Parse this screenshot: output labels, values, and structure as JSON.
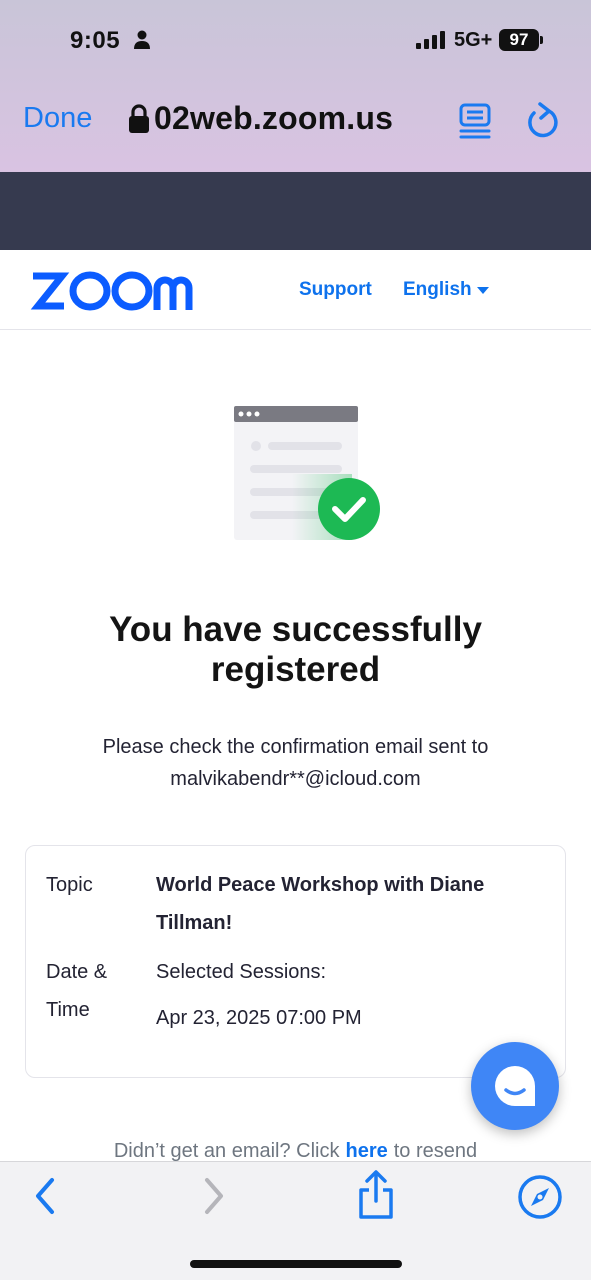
{
  "status_bar": {
    "time": "9:05",
    "network": "5G+",
    "battery": "97"
  },
  "browser": {
    "done_label": "Done",
    "url": "02web.zoom.us"
  },
  "header": {
    "logo_text": "zoom",
    "support_label": "Support",
    "language_label": "English"
  },
  "main": {
    "headline": "You have successfully registered",
    "confirm_line1": "Please check the confirmation email sent to",
    "confirm_email": "malvikabendr**@icloud.com",
    "details": {
      "topic_label": "Topic",
      "topic_value": "World Peace Workshop with Diane Tillman!",
      "date_time_label": "Date & Time",
      "sessions_label": "Selected Sessions:",
      "session_time": "Apr 23, 2025 07:00 PM"
    },
    "resend": {
      "prefix": "Didn’t get an email? Click",
      "link": "here",
      "suffix": "to resend"
    }
  },
  "colors": {
    "zoom_blue": "#0e72ed",
    "success_green": "#1db954",
    "safari_blue": "#1a7af0",
    "chat_blue": "#3f86f6"
  },
  "icons": [
    "person-icon",
    "signal-icon",
    "lock-icon",
    "reader-icon",
    "reload-icon",
    "caret-down-icon",
    "checkmark-icon",
    "chat-icon",
    "back-icon",
    "forward-icon",
    "share-icon",
    "compass-icon"
  ]
}
